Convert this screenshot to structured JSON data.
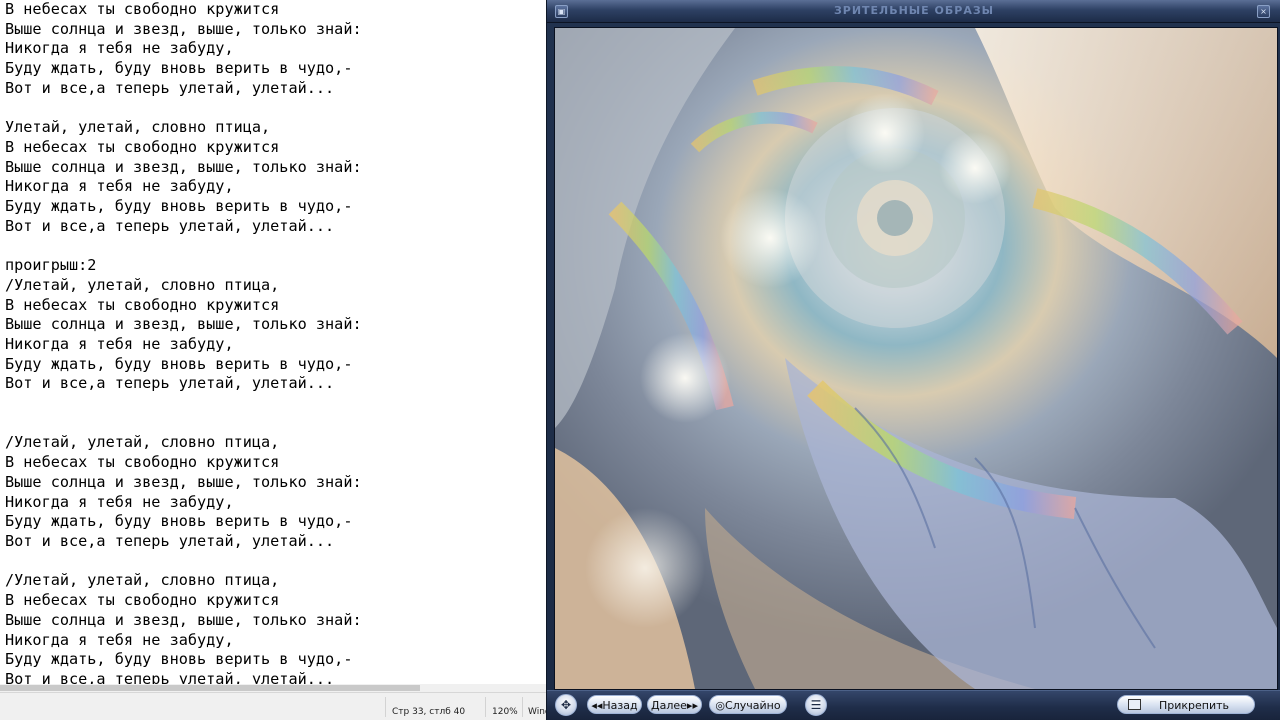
{
  "editor": {
    "lines": [
      "В небесах ты свободно кружится",
      "Выше солнца и звезд, выше, только знай:",
      "Никогда я тебя не забуду,",
      "Буду ждать, буду вновь верить в чудо,-",
      "Вот и все,а теперь улетай, улетай...",
      "",
      "Улетай, улетай, словно птица,",
      "В небесах ты свободно кружится",
      "Выше солнца и звезд, выше, только знай:",
      "Никогда я тебя не забуду,",
      "Буду ждать, буду вновь верить в чудо,-",
      "Вот и все,а теперь улетай, улетай...",
      "",
      "проигрыш:2",
      "/Улетай, улетай, словно птица,",
      "В небесах ты свободно кружится",
      "Выше солнца и звезд, выше, только знай:",
      "Никогда я тебя не забуду,",
      "Буду ждать, буду вновь верить в чудо,-",
      "Вот и все,а теперь улетай, улетай...",
      "",
      "",
      "/Улетай, улетай, словно птица,",
      "В небесах ты свободно кружится",
      "Выше солнца и звезд, выше, только знай:",
      "Никогда я тебя не забуду,",
      "Буду ждать, буду вновь верить в чудо,-",
      "Вот и все,а теперь улетай, улетай...",
      "",
      "/Улетай, улетай, словно птица,",
      "В небесах ты свободно кружится",
      "Выше солнца и звезд, выше, только знай:",
      "Никогда я тебя не забуду,",
      "Буду ждать, буду вновь верить в чудо,-",
      "Вот и все,а теперь улетай, улетай..."
    ]
  },
  "statusbar": {
    "position": "Стр 33, стлб 40",
    "zoom": "120%",
    "line_ending": "Wind"
  },
  "visualizer": {
    "title": "ЗРИТЕЛЬНЫЕ ОБРАЗЫ",
    "back_label": "Назад",
    "next_label": "Далее",
    "random_label": "Случайно",
    "pin_label": "Прикрепить",
    "colors": {
      "frame": "#21324f",
      "title_text": "#6f86b0",
      "button_face": "#dbe4f2"
    }
  }
}
